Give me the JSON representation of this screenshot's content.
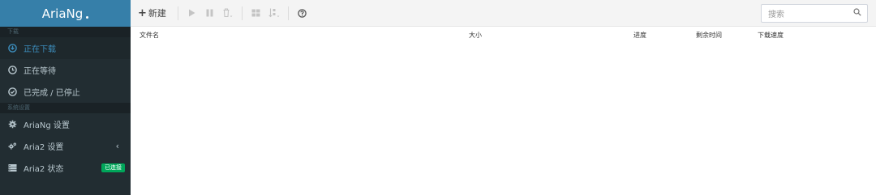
{
  "sidebar": {
    "brand": "AriaNg",
    "download_section": "下载",
    "items": [
      {
        "label": "正在下载",
        "icon": "download-circle-icon",
        "active": true
      },
      {
        "label": "正在等待",
        "icon": "clock-icon"
      },
      {
        "label": "已完成 / 已停止",
        "icon": "check-circle-icon"
      }
    ],
    "settings_section": "系统设置",
    "settings": [
      {
        "label": "AriaNg 设置",
        "icon": "gear-icon"
      },
      {
        "label": "Aria2 设置",
        "icon": "gears-icon",
        "chevron": "‹"
      },
      {
        "label": "Aria2 状态",
        "icon": "server-icon",
        "badge": "已连接"
      }
    ]
  },
  "toolbar": {
    "new_label": "新建"
  },
  "search": {
    "placeholder": "搜索"
  },
  "table": {
    "columns": [
      "文件名",
      "大小",
      "进度",
      "剩余时间",
      "下载速度"
    ]
  },
  "colors": {
    "sidebar_bg": "#222d32",
    "brand_bg": "#367fa9",
    "active_text": "#3c8dbc",
    "badge_bg": "#00a65a"
  }
}
